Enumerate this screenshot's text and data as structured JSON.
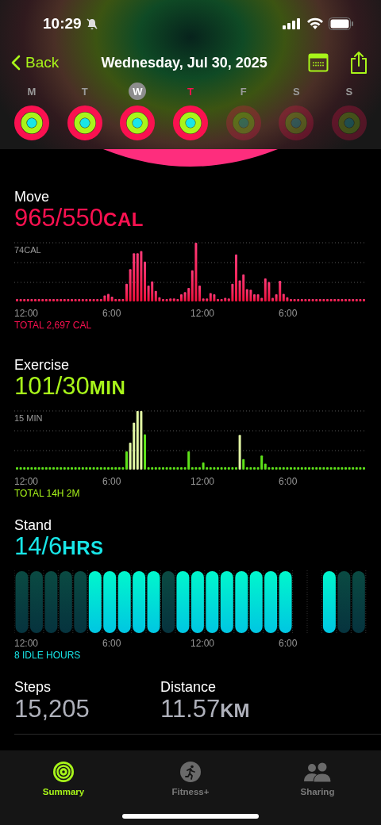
{
  "status_bar": {
    "time": "10:29"
  },
  "nav": {
    "back": "Back",
    "title": "Wednesday, Jul 30, 2025"
  },
  "week": [
    {
      "letter": "M",
      "selected": false,
      "today": false,
      "future": false
    },
    {
      "letter": "T",
      "selected": false,
      "today": false,
      "future": false
    },
    {
      "letter": "W",
      "selected": true,
      "today": false,
      "future": false
    },
    {
      "letter": "T",
      "selected": false,
      "today": true,
      "future": false
    },
    {
      "letter": "F",
      "selected": false,
      "today": false,
      "future": true
    },
    {
      "letter": "S",
      "selected": false,
      "today": false,
      "future": true
    },
    {
      "letter": "S",
      "selected": false,
      "today": false,
      "future": true
    }
  ],
  "metrics": [
    {
      "kind": "move",
      "label": "Move",
      "value": "965/550",
      "unit": "CAL",
      "scale": "74CAL",
      "axis": [
        "12:00",
        "6:00",
        "12:00",
        "6:00"
      ],
      "total": "TOTAL 2,697 CAL"
    },
    {
      "kind": "exercise",
      "label": "Exercise",
      "value": "101/30",
      "unit": "MIN",
      "scale": "15 MIN",
      "axis": [
        "12:00",
        "6:00",
        "12:00",
        "6:00"
      ],
      "total": "TOTAL 14H 2M"
    },
    {
      "kind": "stand",
      "label": "Stand",
      "value": "14/6",
      "unit": "HRS",
      "axis": [
        "12:00",
        "6:00",
        "12:00",
        "6:00"
      ],
      "total": "8 IDLE HOURS"
    }
  ],
  "stats": [
    {
      "label": "Steps",
      "value": "15,205"
    },
    {
      "label": "Distance",
      "value": "11.57",
      "unit": "KM"
    }
  ],
  "tabs": [
    {
      "label": "Summary",
      "selected": true
    },
    {
      "label": "Fitness+",
      "selected": false
    },
    {
      "label": "Sharing",
      "selected": false
    }
  ]
}
